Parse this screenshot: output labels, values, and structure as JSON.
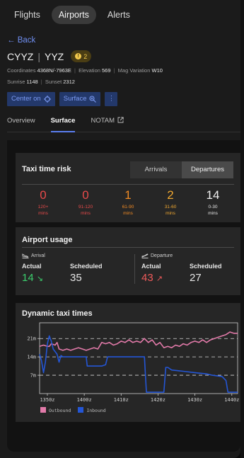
{
  "nav": {
    "tabs": [
      "Flights",
      "Airports",
      "Alerts"
    ],
    "active": 1
  },
  "back_label": "← Back",
  "airport": {
    "icao": "CYYZ",
    "iata": "YYZ",
    "alert_count": "2",
    "coordinates_label": "Coordinates",
    "coordinates": "4368N/-7963E",
    "elevation_label": "Elevation",
    "elevation": "569",
    "magvar_label": "Mag Variation",
    "magvar": "W10",
    "sunrise_label": "Sunrise",
    "sunrise": "1148",
    "sunset_label": "Sunset",
    "sunset": "2312"
  },
  "buttons": {
    "center": "Center on",
    "surface": "Surface",
    "more": "⋮"
  },
  "subtabs": [
    "Overview",
    "Surface",
    "NOTAM"
  ],
  "taxi_risk": {
    "title": "Taxi time risk",
    "toggle": [
      "Arrivals",
      "Departures"
    ],
    "toggle_active": 1,
    "buckets": [
      {
        "value": "0",
        "range": "120+",
        "unit": "mins",
        "color": "#e84a4a"
      },
      {
        "value": "0",
        "range": "91-120",
        "unit": "mins",
        "color": "#e84a4a"
      },
      {
        "value": "1",
        "range": "61-90",
        "unit": "mins",
        "color": "#f08a24"
      },
      {
        "value": "2",
        "range": "31-60",
        "unit": "mins",
        "color": "#f0a830"
      },
      {
        "value": "14",
        "range": "0-30",
        "unit": "mins",
        "color": "#f0f0f0"
      }
    ]
  },
  "usage": {
    "title": "Airport usage",
    "arrival": {
      "label": "Arrival",
      "actual_label": "Actual",
      "scheduled_label": "Scheduled",
      "actual": "14",
      "trend": "↘",
      "scheduled": "35",
      "color": "#3ccf6e"
    },
    "departure": {
      "label": "Departure",
      "actual_label": "Actual",
      "scheduled_label": "Scheduled",
      "actual": "43",
      "trend": "↗",
      "scheduled": "27",
      "color": "#ef5a5a"
    }
  },
  "dynamic": {
    "title": "Dynamic taxi times",
    "legend": [
      "Outbound",
      "Inbound"
    ]
  },
  "chart_data": {
    "type": "line",
    "title": "Dynamic taxi times",
    "x_ticks": [
      "1350z",
      "1400z",
      "1410z",
      "1420z",
      "1430z",
      "1440z"
    ],
    "y_ticks": [
      "21m",
      "14m",
      "7m"
    ],
    "y_tick_values": [
      21,
      14,
      7
    ],
    "xlim": [
      1346,
      1448
    ],
    "ylim": [
      0,
      27
    ],
    "series": [
      {
        "name": "Outbound",
        "color": "#e27aa9",
        "x": [
          1346,
          1348,
          1350,
          1351,
          1352,
          1354,
          1355,
          1356,
          1358,
          1360,
          1362,
          1364,
          1366,
          1368,
          1370,
          1372,
          1374,
          1376,
          1378,
          1380,
          1382,
          1384,
          1386,
          1388,
          1390,
          1392,
          1394,
          1396,
          1398,
          1400,
          1402,
          1404,
          1406,
          1408,
          1410,
          1412,
          1414,
          1416,
          1418,
          1420,
          1422,
          1424,
          1426,
          1428,
          1430,
          1432,
          1434,
          1436,
          1438,
          1440,
          1442,
          1444,
          1446,
          1448
        ],
        "y": [
          18,
          18.5,
          18,
          18,
          19,
          18.5,
          19.5,
          17,
          16.5,
          17,
          16.5,
          17,
          17.5,
          17,
          16.5,
          17,
          17.5,
          17,
          19.5,
          19,
          19.5,
          18.5,
          19,
          20,
          19.5,
          20.5,
          19.5,
          20,
          19.5,
          21,
          19.5,
          20.5,
          18.5,
          19.5,
          17.5,
          18,
          17.5,
          18.5,
          18,
          19,
          18.5,
          19.5,
          20,
          19.5,
          20.5,
          19.5,
          20.5,
          21,
          21.5,
          22,
          22.5,
          23.5,
          23,
          23
        ]
      },
      {
        "name": "Inbound",
        "color": "#2456d6",
        "x": [
          1346,
          1347,
          1348,
          1349,
          1350,
          1351,
          1352,
          1353,
          1355,
          1356,
          1357,
          1358,
          1360,
          1365,
          1370,
          1370.5,
          1378,
          1380,
          1381,
          1382,
          1390,
          1400,
          1401,
          1408,
          1410,
          1411,
          1412,
          1414,
          1420,
          1426,
          1432,
          1435,
          1440,
          1442,
          1443,
          1448
        ],
        "y": [
          15,
          12.5,
          8,
          12,
          19,
          22,
          20,
          17,
          15,
          12,
          14.5,
          14,
          14,
          14,
          14,
          10.5,
          10.5,
          11,
          14,
          14,
          14,
          14,
          0.5,
          0.5,
          0.5,
          10,
          10,
          9,
          8.5,
          8,
          7.5,
          7,
          6.5,
          5,
          0.5,
          0.5
        ]
      }
    ]
  }
}
